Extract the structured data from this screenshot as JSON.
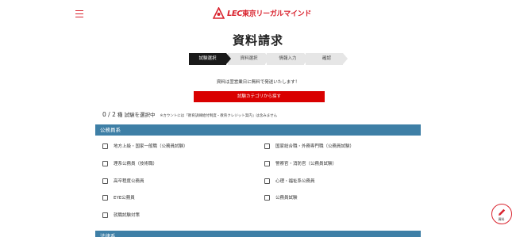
{
  "header": {
    "logo_text": "東京リーガルマインド",
    "logo_mark_text": "LEC"
  },
  "page": {
    "title": "資料請求"
  },
  "steps": [
    {
      "label": "試験選択",
      "active": true
    },
    {
      "label": "資料選択",
      "active": false
    },
    {
      "label": "情報入力",
      "active": false
    },
    {
      "label": "確認",
      "active": false
    }
  ],
  "notice": "資料は翌営業日に無料で発送いたします！",
  "search_button": "試験カテゴリから探す",
  "counter": {
    "selected": "0",
    "separator": " / ",
    "max": "2",
    "suffix": " 種 試験を選択中",
    "note": "※カウントには「教育訓練給付制度・教育クレジット案内」は含みません"
  },
  "sections": [
    {
      "title": "公務員系",
      "options": [
        "地方上級・国家一般職（公務員試験）",
        "国家総合職・外務専門職（公務員試験）",
        "理系公務員（技術職）",
        "警察官・消防官（公務員試験）",
        "高卒程度公務員",
        "心理・福祉系公務員",
        "EYE公務員",
        "公務員試験",
        "就職試験対策"
      ]
    },
    {
      "title": "法律系"
    }
  ],
  "fab": {
    "label": "資料"
  },
  "colors": {
    "brand_red": "#d9232e",
    "button_red": "#d90000",
    "section_blue": "#3e7fa6",
    "step_active": "#1a1a1a",
    "step_inactive": "#e6e6e6"
  }
}
